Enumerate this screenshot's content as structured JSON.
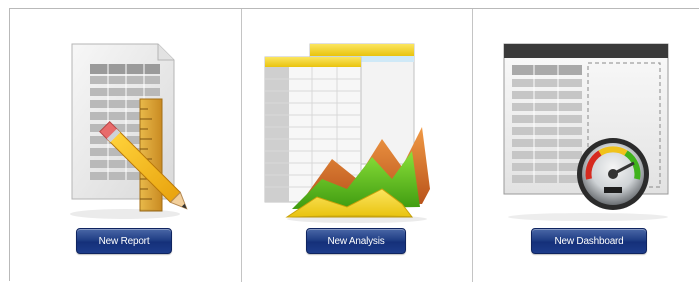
{
  "tiles": [
    {
      "button_label": "New Report",
      "icon": "report-icon"
    },
    {
      "button_label": "New Analysis",
      "icon": "analysis-icon"
    },
    {
      "button_label": "New Dashboard",
      "icon": "dashboard-icon"
    }
  ],
  "colors": {
    "button_blue": "#1d3c8a",
    "border_gray": "#b9b9b9",
    "accent_yellow": "#f3d21b",
    "chart_green": "#62c21e",
    "chart_orange": "#e0702c"
  }
}
